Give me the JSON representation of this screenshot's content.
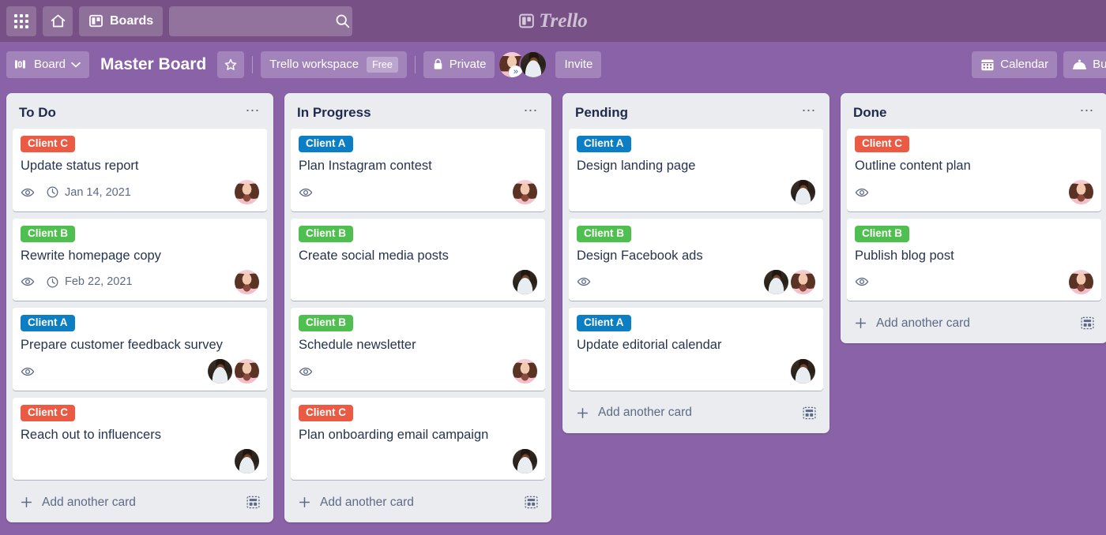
{
  "topnav": {
    "apps_icon": "grid-apps-icon",
    "home_icon": "home-icon",
    "boards_icon": "board-icon",
    "boards_label": "Boards",
    "search_placeholder": "",
    "search_value": "",
    "search_icon": "search-icon",
    "logo_text": "Trello",
    "logo_icon": "trello-logo-icon"
  },
  "boardbar": {
    "view_label": "Board",
    "view_icon": "board-view-icon",
    "chevron_icon": "chevron-down-icon",
    "title": "Master Board",
    "star_icon": "star-icon",
    "workspace_label": "Trello workspace",
    "plan_badge": "Free",
    "visibility_label": "Private",
    "lock_icon": "lock-icon",
    "invite_label": "Invite",
    "members": [
      {
        "name": "member-avatar-1",
        "badge": "»"
      },
      {
        "name": "member-avatar-2",
        "badge": ""
      }
    ],
    "calendar_label": "Calendar",
    "calendar_icon": "calendar-icon",
    "butler_label": "Butl",
    "butler_icon": "butler-bell-icon"
  },
  "colors": {
    "topbar": "#775185",
    "boardbar": "#8a62a7",
    "canvas": "#8a62a7",
    "list_bg": "#ebecf0",
    "card_bg": "#ffffff",
    "label_client_a": "#0b7ec4",
    "label_client_b": "#4fc04f",
    "label_client_c": "#eb5a42",
    "text_dark": "#27344e",
    "text_muted": "#5d6a86"
  },
  "add_card": {
    "label": "Add another card",
    "plus_icon": "plus-icon",
    "template_icon": "card-template-icon"
  },
  "lists": [
    {
      "title": "To Do",
      "menu_icon": "list-menu-icon",
      "cards": [
        {
          "label": "Client C",
          "label_color": "#eb5a42",
          "title": "Update status report",
          "watch_icon": "eye-icon",
          "due_icon": "clock-icon",
          "due": "Jan 14, 2021",
          "members": [
            "avatar-female"
          ]
        },
        {
          "label": "Client B",
          "label_color": "#4fc04f",
          "title": "Rewrite homepage copy",
          "watch_icon": "eye-icon",
          "due_icon": "clock-icon",
          "due": "Feb 22, 2021",
          "members": [
            "avatar-female"
          ]
        },
        {
          "label": "Client A",
          "label_color": "#0b7ec4",
          "title": "Prepare customer feedback survey",
          "watch_icon": "eye-icon",
          "due_icon": "",
          "due": "",
          "members": [
            "avatar-male",
            "avatar-female"
          ]
        },
        {
          "label": "Client C",
          "label_color": "#eb5a42",
          "title": "Reach out to influencers",
          "watch_icon": "",
          "due_icon": "",
          "due": "",
          "members": [
            "avatar-male"
          ]
        }
      ]
    },
    {
      "title": "In Progress",
      "menu_icon": "list-menu-icon",
      "cards": [
        {
          "label": "Client A",
          "label_color": "#0b7ec4",
          "title": "Plan Instagram contest",
          "watch_icon": "eye-icon",
          "due_icon": "",
          "due": "",
          "members": [
            "avatar-female"
          ]
        },
        {
          "label": "Client B",
          "label_color": "#4fc04f",
          "title": "Create social media posts",
          "watch_icon": "",
          "due_icon": "",
          "due": "",
          "members": [
            "avatar-male"
          ]
        },
        {
          "label": "Client B",
          "label_color": "#4fc04f",
          "title": "Schedule newsletter",
          "watch_icon": "eye-icon",
          "due_icon": "",
          "due": "",
          "members": [
            "avatar-female"
          ]
        },
        {
          "label": "Client C",
          "label_color": "#eb5a42",
          "title": "Plan onboarding email campaign",
          "watch_icon": "",
          "due_icon": "",
          "due": "",
          "members": [
            "avatar-male"
          ]
        }
      ]
    },
    {
      "title": "Pending",
      "menu_icon": "list-menu-icon",
      "cards": [
        {
          "label": "Client A",
          "label_color": "#0b7ec4",
          "title": "Design landing page",
          "watch_icon": "",
          "due_icon": "",
          "due": "",
          "members": [
            "avatar-male"
          ]
        },
        {
          "label": "Client B",
          "label_color": "#4fc04f",
          "title": "Design Facebook ads",
          "watch_icon": "eye-icon",
          "due_icon": "",
          "due": "",
          "members": [
            "avatar-male",
            "avatar-female"
          ]
        },
        {
          "label": "Client A",
          "label_color": "#0b7ec4",
          "title": "Update editorial calendar",
          "watch_icon": "",
          "due_icon": "",
          "due": "",
          "members": [
            "avatar-male"
          ]
        }
      ]
    },
    {
      "title": "Done",
      "menu_icon": "list-menu-icon",
      "cards": [
        {
          "label": "Client C",
          "label_color": "#eb5a42",
          "title": "Outline content plan",
          "watch_icon": "eye-icon",
          "due_icon": "",
          "due": "",
          "members": [
            "avatar-female"
          ]
        },
        {
          "label": "Client B",
          "label_color": "#4fc04f",
          "title": "Publish blog post",
          "watch_icon": "eye-icon",
          "due_icon": "",
          "due": "",
          "members": [
            "avatar-female"
          ]
        }
      ]
    }
  ]
}
